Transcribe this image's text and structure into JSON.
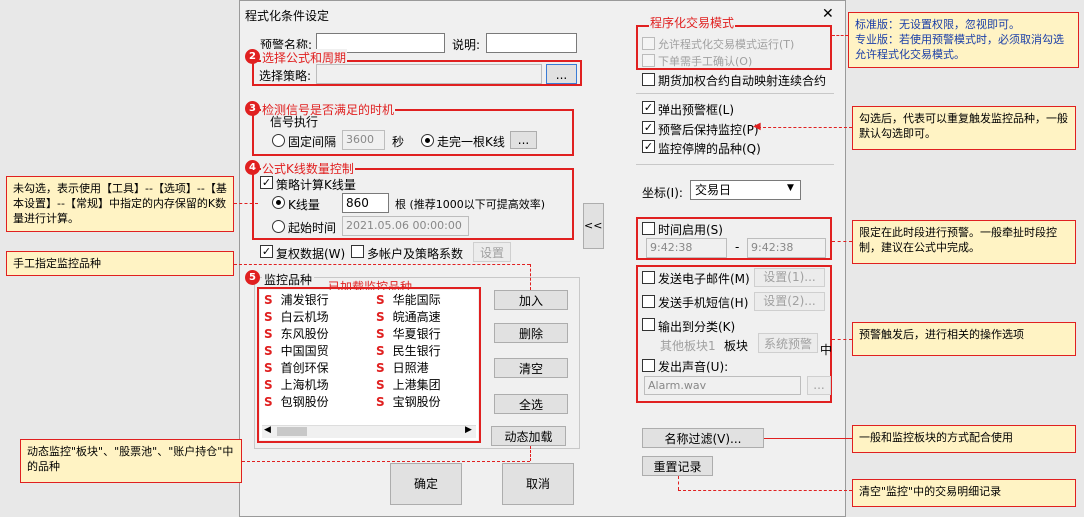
{
  "dialog": {
    "title": "程式化条件设定",
    "close": "✕"
  },
  "form": {
    "alert_name_label": "预警名称:",
    "desc_label": "说明:",
    "strategy_label": "选择策略:",
    "browse": "...",
    "signal_legend": "信号执行",
    "fixed_interval": "固定间隔",
    "interval_value": "3600",
    "seconds": "秒",
    "after_bar": "走完一根K线",
    "bar_btn": "...",
    "strategy_bars": "策略计算K线量",
    "bar_count_label": "K线量",
    "bar_count": "860",
    "bar_hint": "根 (推荐1000以下可提高效率)",
    "start_time_label": "起始时间",
    "start_time": "2021.05.06 00:00:00",
    "adjusted": "复权数据(W)",
    "multi_account": "多帐户及策略系数",
    "setting": "设置",
    "monitor_legend": "监控品种",
    "add": "加入",
    "delete": "删除",
    "clear": "清空",
    "select_all": "全选",
    "dynamic_load": "动态加载",
    "ok": "确定",
    "cancel": "取消",
    "collapse": "<<<"
  },
  "stocks_left": [
    "浦发银行",
    "白云机场",
    "东风股份",
    "中国国贸",
    "首创环保",
    "上海机场",
    "包钢股份"
  ],
  "stocks_right": [
    "华能国际",
    "皖通高速",
    "华夏银行",
    "民生银行",
    "日照港",
    "上港集团",
    "宝钢股份"
  ],
  "stock_marker": "S",
  "right": {
    "allow_auto_trade": "允许程式化交易模式运行(T)",
    "manual_confirm": "下单需手工确认(O)",
    "futures_map": "期货加权合约自动映射连续合约",
    "popup": "弹出预警框(L)",
    "keep_monitor": "预警后保持监控(P)",
    "suspended": "监控停牌的品种(Q)",
    "coord_label": "坐标(I):",
    "coord_value": "交易日",
    "time_enable": "时间启用(S)",
    "time_from": "9:42:38",
    "time_to": "9:42:38",
    "dash": "-",
    "email": "发送电子邮件(M)",
    "email_btn": "设置(1)...",
    "sms": "发送手机短信(H)",
    "sms_btn": "设置(2)...",
    "classify": "输出到分类(K)",
    "other_block": "其他板块1",
    "block_label": "板块",
    "sys_alert": "系统预警",
    "zhong": "中",
    "sound": "发出声音(U):",
    "sound_file": "Alarm.wav",
    "sound_btn": "...",
    "name_filter": "名称过滤(V)...",
    "reset_record": "重置记录"
  },
  "annotations": {
    "auto_trade_mode": "程序化交易模式",
    "select_formula": "选择公式和周期",
    "detect_signal": "检测信号是否满足的时机",
    "bar_control": "公式K线数量控制",
    "loaded_monitor": "已加载监控品种",
    "n2": "2",
    "n3": "3",
    "n4": "4",
    "n5": "5",
    "note_std": "标准版：无设置权限，忽视即可。",
    "note_pro": "专业版：若使用预警模式时，必须取消勾选允许程式化交易模式。",
    "note_keep": "勾选后，代表可以重复触发监控品种，一般默认勾选即可。",
    "note_unchecked": "未勾选，表示使用【工具】--【选项】--【基本设置】--【常规】中指定的内存保留的K数量进行计算。",
    "note_manual": "手工指定监控品种",
    "note_time": "限定在此时段进行预警。一般牵扯时段控制，建议在公式中完成。",
    "note_actions": "预警触发后，进行相关的操作选项",
    "note_dynamic": "动态监控\"板块\"、\"股票池\"、\"账户持仓\"中的品种",
    "note_filter": "一般和监控板块的方式配合使用",
    "note_reset": "清空\"监控\"中的交易明细记录"
  }
}
